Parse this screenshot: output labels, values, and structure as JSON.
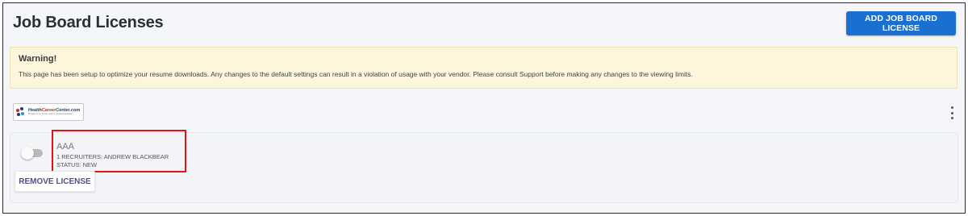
{
  "header": {
    "title": "Job Board Licenses",
    "add_button_label": "ADD JOB BOARD LICENSE"
  },
  "warning": {
    "title": "Warning!",
    "text": "This page has been setup to optimize your resume downloads. Any changes to the default settings can result in a violation of usage with your vendor. Please consult Support before making any changes to the viewing limits."
  },
  "job_board": {
    "logo_text_part1": "Health",
    "logo_text_part2": "Career",
    "logo_text_part3": "Center.com",
    "logo_tagline": "Brought to you by the nation's hospital association",
    "menu_icon": "kebab-vertical-icon"
  },
  "license": {
    "name": "AAA",
    "recruiters": "1 RECRUITERS: ANDREW BLACKBEAR",
    "status": "STATUS: NEW",
    "enabled": false,
    "remove_button_label": "REMOVE LICENSE"
  },
  "colors": {
    "accent": "#1b6fd0",
    "warning_bg": "#fdf5dc",
    "highlight": "#e01414",
    "remove_text": "#5b4a8a"
  }
}
